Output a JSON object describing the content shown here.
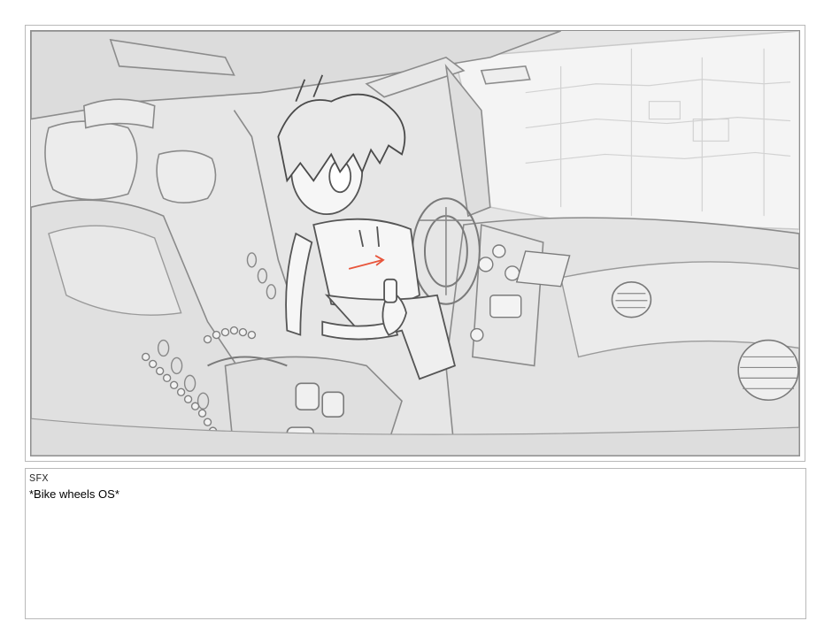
{
  "panel": {
    "image_description_icon": "storyboard-sketch",
    "accent_color": "#e8553b"
  },
  "notes": {
    "label": "SFX",
    "text": "*Bike wheels OS*"
  }
}
